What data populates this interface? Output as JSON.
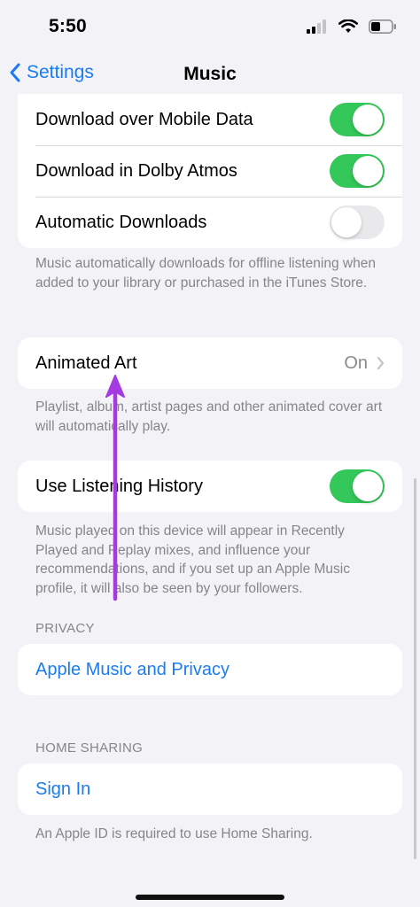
{
  "status_bar": {
    "time": "5:50"
  },
  "nav": {
    "back_label": "Settings",
    "title": "Music"
  },
  "downloads_group": {
    "rows": [
      {
        "label": "Download over Mobile Data",
        "toggle": "on"
      },
      {
        "label": "Download in Dolby Atmos",
        "toggle": "on"
      },
      {
        "label": "Automatic Downloads",
        "toggle": "off"
      }
    ],
    "footer": "Music automatically downloads for offline listening when added to your library or purchased in the iTunes Store."
  },
  "animated_art": {
    "label": "Animated Art",
    "value": "On",
    "footer": "Playlist, album, artist pages and other animated cover art will automatically play."
  },
  "listening_history": {
    "label": "Use Listening History",
    "toggle": "on",
    "footer": "Music played on this device will appear in Recently Played and Replay mixes, and influence your recommendations, and if you set up an Apple Music profile, it will also be seen by your followers."
  },
  "privacy": {
    "header": "PRIVACY",
    "link_label": "Apple Music and Privacy"
  },
  "home_sharing": {
    "header": "HOME SHARING",
    "link_label": "Sign In",
    "footer": "An Apple ID is required to use Home Sharing."
  },
  "colors": {
    "accent": "#1a7cf2",
    "toggle_on": "#34c759",
    "annotation_arrow": "#a53ae0"
  }
}
